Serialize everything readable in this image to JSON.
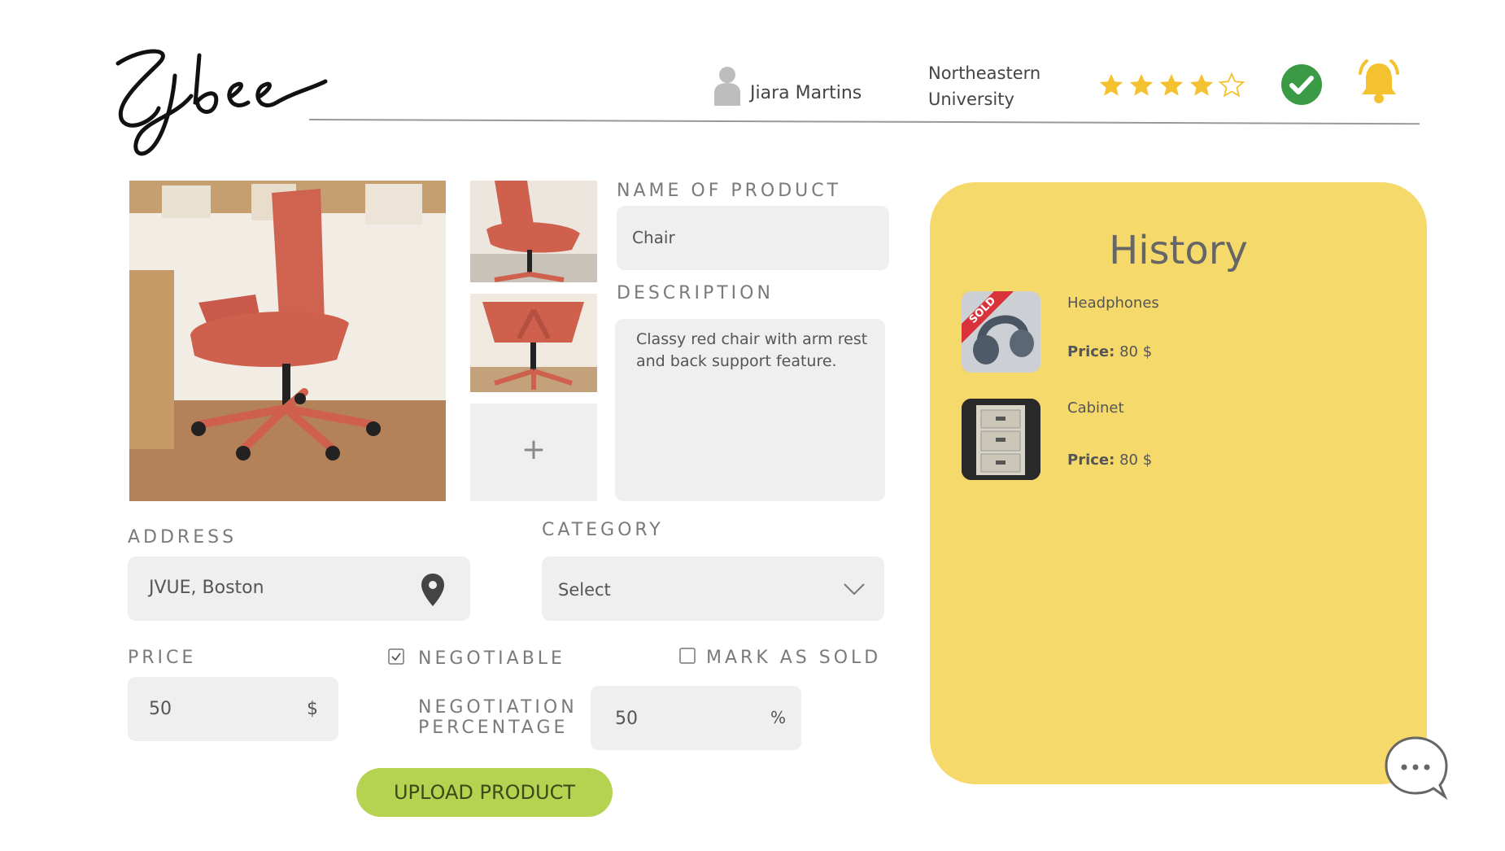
{
  "header": {
    "logo_text": "Cigbee",
    "user_name": "Jiara Martins",
    "university_line1": "Northeastern",
    "university_line2": "University",
    "rating": 4,
    "rating_max": 5,
    "icons": {
      "user": "user-icon",
      "verified": "verified-check-icon",
      "notifications": "bell-icon"
    }
  },
  "form": {
    "name_label": "NAME OF PRODUCT",
    "name_value": "Chair",
    "description_label": "DESCRIPTION",
    "description_value": "Classy red chair with arm rest and back support feature.",
    "add_image_symbol": "+",
    "address_label": "ADDRESS",
    "address_value": "JVUE, Boston",
    "category_label": "CATEGORY",
    "category_value": "Select",
    "price_label": "PRICE",
    "price_value": "50",
    "price_unit": "$",
    "negotiable_label": "NEGOTIABLE",
    "negotiable_checked": true,
    "mark_sold_label": "MARK AS SOLD",
    "mark_sold_checked": false,
    "negotiation_label_line1": "NEGOTIATION",
    "negotiation_label_line2": "PERCENTAGE",
    "negotiation_value": "50",
    "negotiation_unit": "%",
    "upload_button": "UPLOAD PRODUCT"
  },
  "history": {
    "title": "History",
    "items": [
      {
        "name": "Headphones",
        "price_label": "Price:",
        "price_value": "80 $",
        "badge": "SOLD"
      },
      {
        "name": "Cabinet",
        "price_label": "Price:",
        "price_value": "80 $"
      }
    ]
  },
  "colors": {
    "history_bg": "#f5d96b",
    "upload_button_bg": "#b5d251",
    "star": "#f4c230",
    "verified": "#3a9a45",
    "bell": "#f4c230",
    "sold_badge": "#d8323b"
  }
}
